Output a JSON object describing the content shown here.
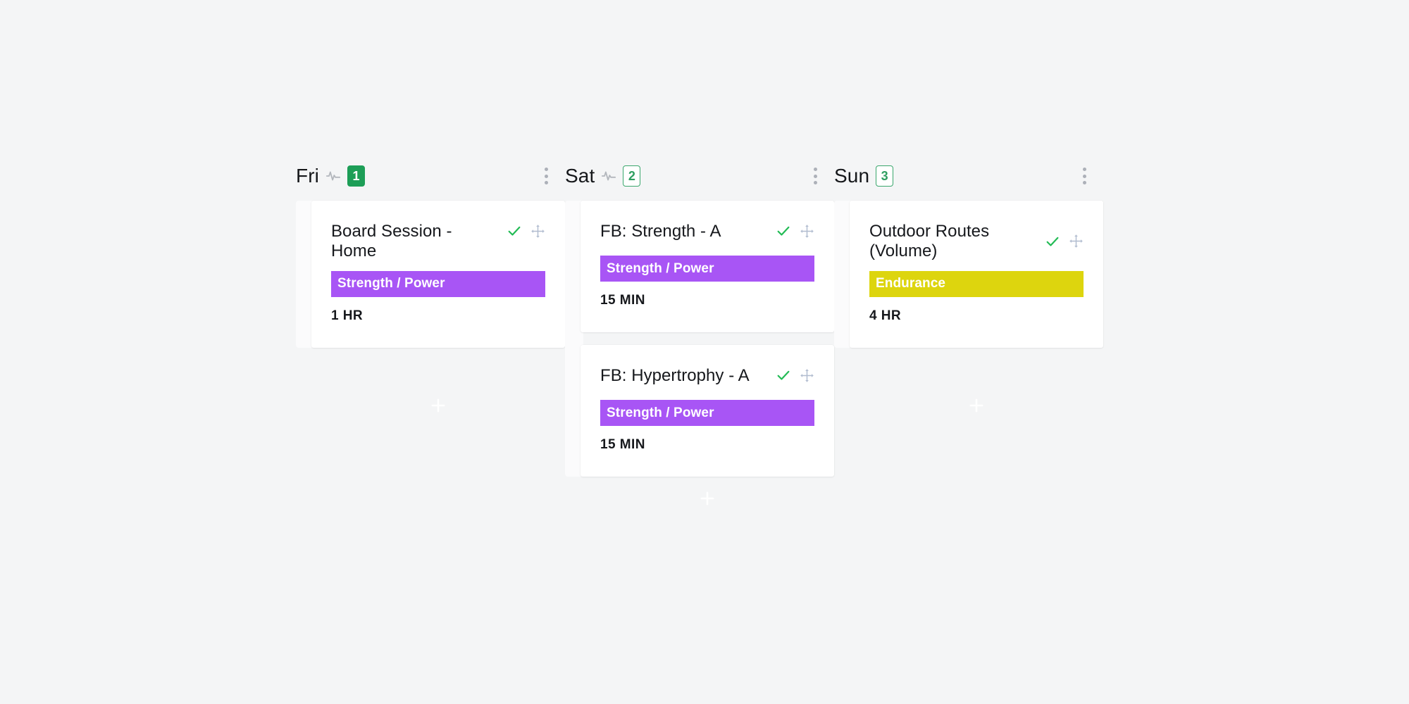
{
  "board": {
    "background_color": "#f4f5f6",
    "columns": [
      {
        "day": "Fri",
        "pulse_icon": "activity-icon",
        "badge": {
          "value": "1",
          "style": "solid",
          "color": "#1d9e57"
        },
        "menu_icon": "kebab-menu-icon",
        "add_label": "+",
        "cards": [
          {
            "title": "Board Session - Home",
            "tag": {
              "label": "Strength / Power",
              "color": "#a855f5"
            },
            "duration": "1 HR",
            "check_icon": "check-icon",
            "move_icon": "move-icon",
            "title_wraps": false
          }
        ]
      },
      {
        "day": "Sat",
        "pulse_icon": "activity-icon",
        "badge": {
          "value": "2",
          "style": "outline",
          "color": "#3aa76d"
        },
        "menu_icon": "kebab-menu-icon",
        "add_label": "+",
        "cards": [
          {
            "title": "FB: Strength - A",
            "tag": {
              "label": "Strength / Power",
              "color": "#a855f5"
            },
            "duration": "15 MIN",
            "check_icon": "check-icon",
            "move_icon": "move-icon",
            "title_wraps": false
          },
          {
            "title": "FB: Hypertrophy - A",
            "tag": {
              "label": "Strength / Power",
              "color": "#a855f5"
            },
            "duration": "15 MIN",
            "check_icon": "check-icon",
            "move_icon": "move-icon",
            "title_wraps": false
          }
        ]
      },
      {
        "day": "Sun",
        "pulse_icon": null,
        "badge": {
          "value": "3",
          "style": "outline",
          "color": "#3aa76d"
        },
        "menu_icon": "kebab-menu-icon",
        "add_label": "+",
        "cards": [
          {
            "title": "Outdoor Routes (Volume)",
            "tag": {
              "label": "Endurance",
              "color": "#ddd50e"
            },
            "duration": "4 HR",
            "check_icon": "check-icon",
            "move_icon": "move-icon",
            "title_wraps": true
          }
        ]
      }
    ]
  }
}
